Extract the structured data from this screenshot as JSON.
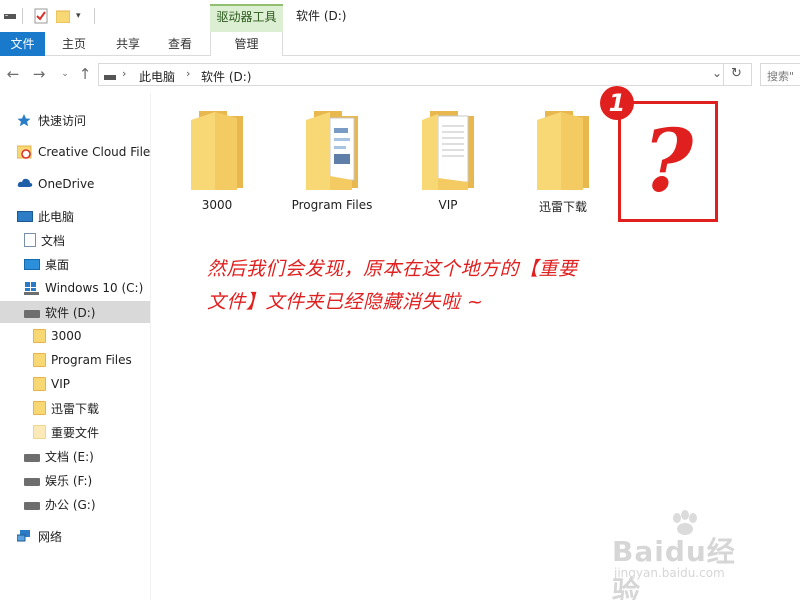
{
  "window": {
    "title": "软件 (D:)",
    "context_group": "驱动器工具"
  },
  "ribbon": {
    "tabs": [
      "文件",
      "主页",
      "共享",
      "查看",
      "管理"
    ]
  },
  "address": {
    "breadcrumb": [
      "此电脑",
      "软件 (D:)"
    ],
    "search_placeholder": "搜索\""
  },
  "sidebar": {
    "items": [
      {
        "label": "快速访问",
        "icon": "star-icon"
      },
      {
        "label": "Creative Cloud Files",
        "icon": "creative-cloud-folder-icon"
      },
      {
        "label": "OneDrive",
        "icon": "cloud-icon"
      },
      {
        "label": "此电脑",
        "icon": "computer-icon"
      },
      {
        "label": "文档",
        "icon": "document-icon"
      },
      {
        "label": "桌面",
        "icon": "desktop-icon"
      },
      {
        "label": "Windows 10 (C:)",
        "icon": "windows-drive-icon"
      },
      {
        "label": "软件 (D:)",
        "icon": "drive-icon",
        "selected": true
      },
      {
        "label": "3000",
        "icon": "folder-icon"
      },
      {
        "label": "Program Files",
        "icon": "folder-icon"
      },
      {
        "label": "VIP",
        "icon": "folder-icon"
      },
      {
        "label": "迅雷下载",
        "icon": "folder-icon"
      },
      {
        "label": "重要文件",
        "icon": "hidden-folder-icon"
      },
      {
        "label": "文档 (E:)",
        "icon": "drive-icon"
      },
      {
        "label": "娱乐 (F:)",
        "icon": "drive-icon"
      },
      {
        "label": "办公 (G:)",
        "icon": "drive-icon"
      },
      {
        "label": "网络",
        "icon": "network-icon"
      }
    ]
  },
  "content": {
    "items": [
      {
        "label": "3000",
        "icon": "folder-icon"
      },
      {
        "label": "Program Files",
        "icon": "folder-with-files-icon"
      },
      {
        "label": "VIP",
        "icon": "folder-with-documents-icon"
      },
      {
        "label": "迅雷下载",
        "icon": "folder-icon"
      }
    ],
    "missing_marker": "?",
    "badge_number": "1"
  },
  "annotation": {
    "line1": "然后我们会发现，原本在这个地方的【重要",
    "line2": "文件】文件夹已经隐藏消失啦 ~"
  },
  "watermark": {
    "logo": "Baidu经验",
    "url": "jingyan.baidu.com"
  },
  "colors": {
    "accent": "#1979ca",
    "annotation_red": "#e0201f",
    "folder_yellow": "#f8d775",
    "context_green": "#dcefd2",
    "selected_bg": "#d9d9d9"
  }
}
